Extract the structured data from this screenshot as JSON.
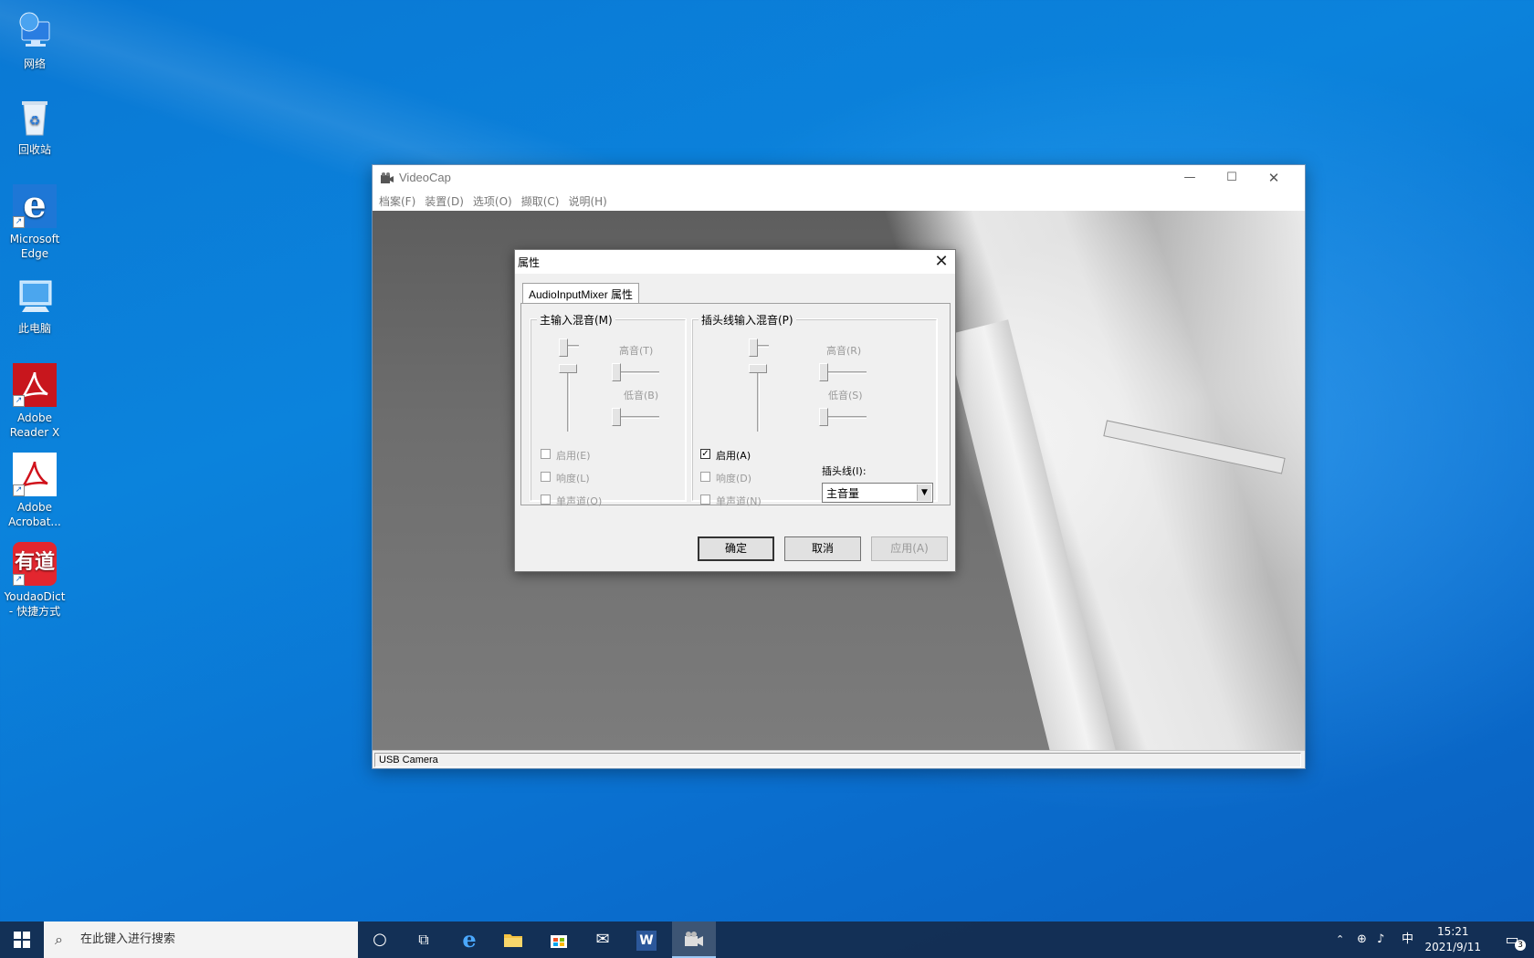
{
  "desktop": {
    "icons": [
      {
        "label": "网络"
      },
      {
        "label": "回收站"
      },
      {
        "label": "Microsoft Edge"
      },
      {
        "label": "此电脑"
      },
      {
        "label": "Adobe Reader X"
      },
      {
        "label": "Adobe Acrobat..."
      },
      {
        "label": "YoudaoDict - 快捷方式"
      }
    ]
  },
  "window": {
    "title": "VideoCap",
    "minimize": "—",
    "maximize": "☐",
    "close": "✕",
    "menu": [
      "档案(F)",
      "装置(D)",
      "选项(O)",
      "撷取(C)",
      "说明(H)"
    ],
    "status": "USB Camera"
  },
  "dialog": {
    "title": "属性",
    "close": "✕",
    "tab": "AudioInputMixer 属性",
    "main_group": {
      "caption": "主输入混音(M)",
      "treble": "高音(T)",
      "bass": "低音(B)",
      "enable": "启用(E)",
      "loudness": "响度(L)",
      "mono": "单声道(O)",
      "enable_checked": false
    },
    "line_group": {
      "caption": "插头线输入混音(P)",
      "treble": "高音(R)",
      "bass": "低音(S)",
      "enable": "启用(A)",
      "loudness": "响度(D)",
      "mono": "单声道(N)",
      "enable_checked": true,
      "enable_mark": "✓",
      "pin_label": "插头线(I):",
      "pin_value": "主音量"
    },
    "ok": "确定",
    "cancel": "取消",
    "apply": "应用(A)"
  },
  "taskbar": {
    "search_placeholder": "在此键入进行搜索",
    "tray_ime": "中",
    "time": "15:21",
    "date": "2021/9/11",
    "notification_count": "3"
  }
}
